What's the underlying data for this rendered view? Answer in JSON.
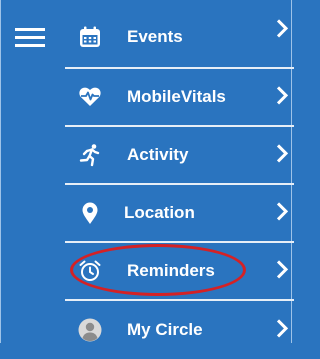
{
  "menu_button": {
    "icon": "hamburger-icon"
  },
  "menu": {
    "items": [
      {
        "label": "Events",
        "icon": "calendar-icon"
      },
      {
        "label": "MobileVitals",
        "icon": "heart-pulse-icon"
      },
      {
        "label": "Activity",
        "icon": "running-person-icon"
      },
      {
        "label": "Location",
        "icon": "map-pin-icon"
      },
      {
        "label": "Reminders",
        "icon": "alarm-clock-icon"
      },
      {
        "label": "My Circle",
        "icon": "person-icon"
      }
    ]
  },
  "colors": {
    "background": "#2a74bf",
    "text": "#ffffff",
    "highlight_ring": "#d42125"
  }
}
